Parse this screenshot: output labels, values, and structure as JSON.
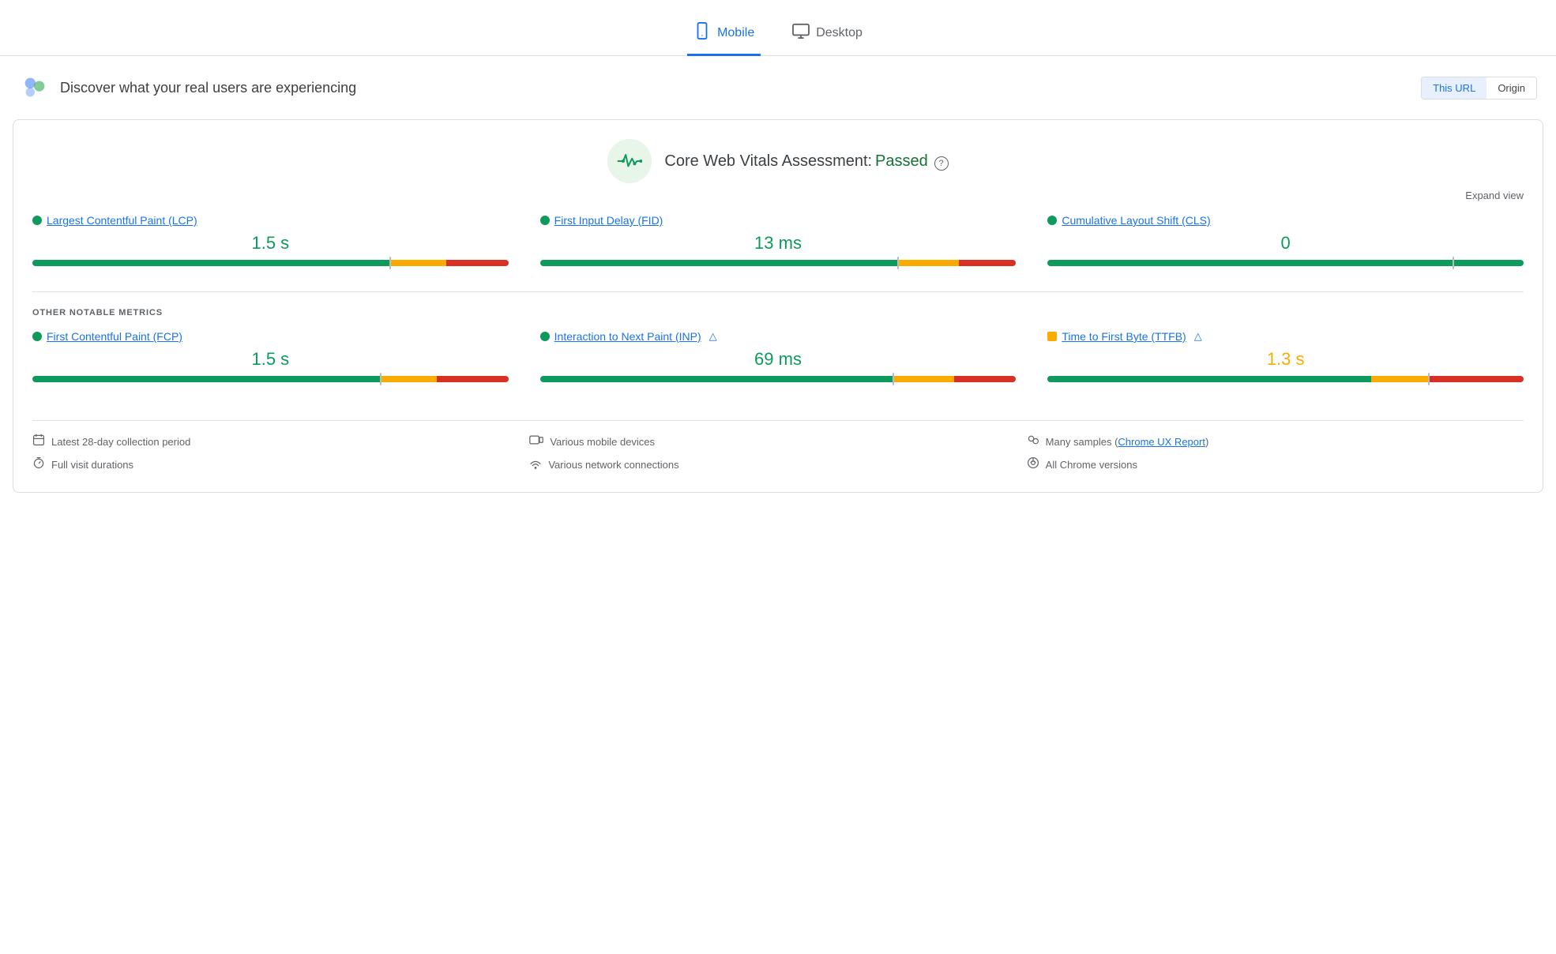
{
  "tabs": [
    {
      "id": "mobile",
      "label": "Mobile",
      "active": true,
      "icon": "📱"
    },
    {
      "id": "desktop",
      "label": "Desktop",
      "active": false,
      "icon": "🖥"
    }
  ],
  "header": {
    "title": "Discover what your real users are experiencing",
    "url_toggle": {
      "this_url": "This URL",
      "origin": "Origin",
      "active": "this_url"
    }
  },
  "vitals": {
    "assessment_label": "Core Web Vitals Assessment:",
    "assessment_status": "Passed",
    "help_icon": "?",
    "expand_label": "Expand view"
  },
  "core_metrics": [
    {
      "id": "lcp",
      "name": "Largest Contentful Paint (LCP)",
      "value": "1.5 s",
      "value_color": "green",
      "dot_color": "green",
      "bar": {
        "green": 75,
        "orange": 12,
        "red": 13,
        "marker": 75
      }
    },
    {
      "id": "fid",
      "name": "First Input Delay (FID)",
      "value": "13 ms",
      "value_color": "green",
      "dot_color": "green",
      "bar": {
        "green": 75,
        "orange": 13,
        "red": 12,
        "marker": 75
      }
    },
    {
      "id": "cls",
      "name": "Cumulative Layout Shift (CLS)",
      "value": "0",
      "value_color": "green",
      "dot_color": "green",
      "bar": {
        "green": 100,
        "orange": 0,
        "red": 0,
        "marker": 85
      }
    }
  ],
  "other_metrics_label": "OTHER NOTABLE METRICS",
  "other_metrics": [
    {
      "id": "fcp",
      "name": "First Contentful Paint (FCP)",
      "value": "1.5 s",
      "value_color": "green",
      "dot_color": "green",
      "has_lab": false,
      "bar": {
        "green": 73,
        "orange": 12,
        "red": 15,
        "marker": 73
      }
    },
    {
      "id": "inp",
      "name": "Interaction to Next Paint (INP)",
      "value": "69 ms",
      "value_color": "green",
      "dot_color": "green",
      "has_lab": true,
      "bar": {
        "green": 74,
        "orange": 13,
        "red": 13,
        "marker": 74
      }
    },
    {
      "id": "ttfb",
      "name": "Time to First Byte (TTFB)",
      "value": "1.3 s",
      "value_color": "orange",
      "dot_color": "orange",
      "dot_shape": "square",
      "has_lab": true,
      "bar": {
        "green": 68,
        "orange": 12,
        "red": 20,
        "marker": 80
      }
    }
  ],
  "footer": {
    "col1": [
      {
        "icon": "📅",
        "text": "Latest 28-day collection period"
      },
      {
        "icon": "⏱",
        "text": "Full visit durations"
      }
    ],
    "col2": [
      {
        "icon": "📱",
        "text": "Various mobile devices"
      },
      {
        "icon": "📶",
        "text": "Various network connections"
      }
    ],
    "col3": [
      {
        "icon": "👥",
        "text_before": "Many samples (",
        "link": "Chrome UX Report",
        "text_after": ")"
      },
      {
        "icon": "🌐",
        "text": "All Chrome versions"
      }
    ]
  }
}
